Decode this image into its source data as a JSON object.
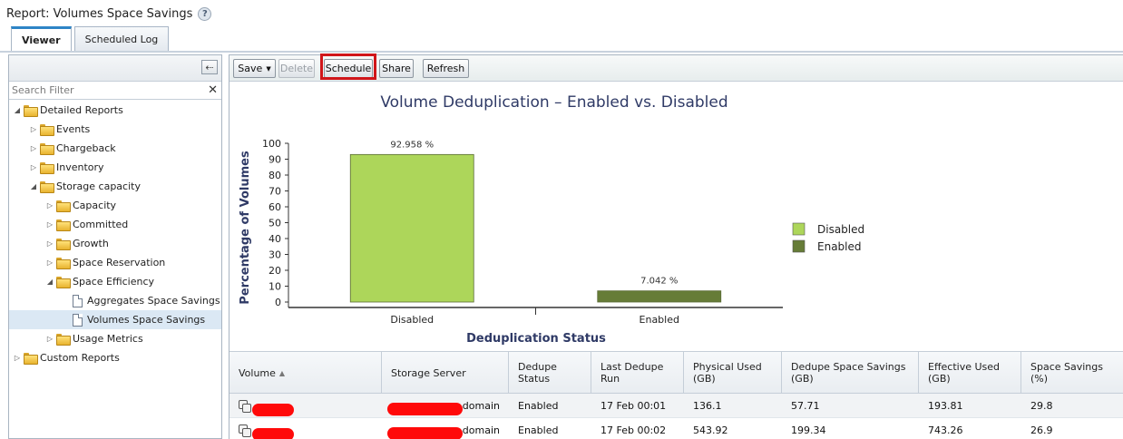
{
  "header": {
    "title": "Report: Volumes Space Savings",
    "help_glyph": "?"
  },
  "tabs": [
    {
      "label": "Viewer",
      "active": true
    },
    {
      "label": "Scheduled Log",
      "active": false
    }
  ],
  "left_panel": {
    "collapse_glyph": "⇠",
    "search_placeholder": "Search Filter",
    "clear_glyph": "✕",
    "tree": [
      {
        "label": "Detailed Reports",
        "depth": 0,
        "expanded": true,
        "icon": "folder"
      },
      {
        "label": "Events",
        "depth": 1,
        "expanded": false,
        "icon": "folder"
      },
      {
        "label": "Chargeback",
        "depth": 1,
        "expanded": false,
        "icon": "folder"
      },
      {
        "label": "Inventory",
        "depth": 1,
        "expanded": false,
        "icon": "folder"
      },
      {
        "label": "Storage capacity",
        "depth": 1,
        "expanded": true,
        "icon": "folder"
      },
      {
        "label": "Capacity",
        "depth": 2,
        "expanded": false,
        "icon": "folder"
      },
      {
        "label": "Committed",
        "depth": 2,
        "expanded": false,
        "icon": "folder"
      },
      {
        "label": "Growth",
        "depth": 2,
        "expanded": false,
        "icon": "folder"
      },
      {
        "label": "Space Reservation",
        "depth": 2,
        "expanded": false,
        "icon": "folder"
      },
      {
        "label": "Space Efficiency",
        "depth": 2,
        "expanded": true,
        "icon": "folder"
      },
      {
        "label": "Aggregates Space Savings",
        "depth": 3,
        "icon": "report"
      },
      {
        "label": "Volumes Space Savings",
        "depth": 3,
        "icon": "report",
        "selected": true
      },
      {
        "label": "Usage Metrics",
        "depth": 2,
        "expanded": false,
        "icon": "folder"
      },
      {
        "label": "Custom Reports",
        "depth": 0,
        "expanded": false,
        "icon": "folder"
      }
    ]
  },
  "toolbar": {
    "save_label": "Save",
    "delete_label": "Delete",
    "schedule_label": "Schedule",
    "share_label": "Share",
    "refresh_label": "Refresh"
  },
  "chart_data": {
    "type": "bar",
    "title": "Volume Deduplication – Enabled vs. Disabled",
    "xlabel": "Deduplication Status",
    "ylabel": "Percentage of Volumes",
    "categories": [
      "Disabled",
      "Enabled"
    ],
    "values": [
      92.958,
      7.042
    ],
    "data_labels": [
      "92.958 %",
      "7.042 %"
    ],
    "colors": [
      "#add65a",
      "#667c37"
    ],
    "ylim": [
      0,
      100
    ],
    "yticks": [
      0,
      10,
      20,
      30,
      40,
      50,
      60,
      70,
      80,
      90,
      100
    ],
    "legend": [
      {
        "label": "Disabled",
        "color": "#add65a"
      },
      {
        "label": "Enabled",
        "color": "#667c37"
      }
    ],
    "legend_position": "right",
    "grid": false
  },
  "table": {
    "columns": [
      {
        "label": "Volume",
        "sort": "▲"
      },
      {
        "label": "Storage Server"
      },
      {
        "label": "Dedupe Status"
      },
      {
        "label": "Last Dedupe Run"
      },
      {
        "label": "Physical Used (GB)"
      },
      {
        "label": "Dedupe Space Savings (GB)"
      },
      {
        "label": "Effective Used (GB)"
      },
      {
        "label": "Space Savings (%)"
      }
    ],
    "rows": [
      {
        "server_suffix": "domain",
        "status": "Enabled",
        "last_run": "17 Feb  00:01",
        "physical": "136.1",
        "savings_gb": "57.71",
        "effective": "193.81",
        "savings_pct": "29.8"
      },
      {
        "server_suffix": "domain",
        "status": "Enabled",
        "last_run": "17 Feb  00:02",
        "physical": "543.92",
        "savings_gb": "199.34",
        "effective": "743.26",
        "savings_pct": "26.9"
      }
    ]
  },
  "colors": {
    "highlight": "#d0161a",
    "redaction": "#ff0a0a",
    "accent": "#2e84c6"
  }
}
